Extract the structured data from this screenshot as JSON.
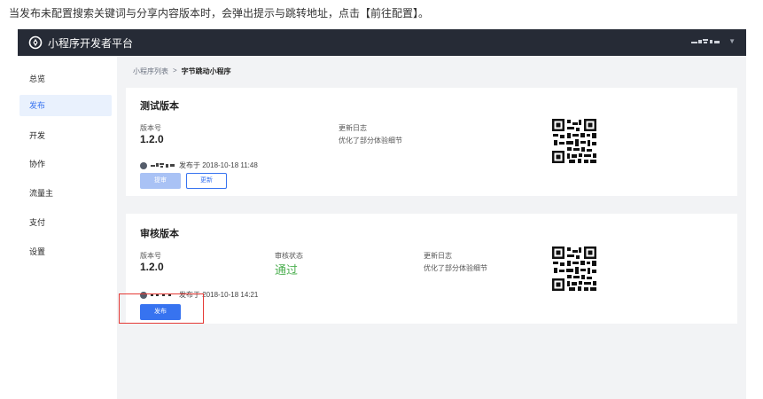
{
  "caption": "当发布未配置搜索关键词与分享内容版本时，会弹出提示与跳转地址，点击【前往配置】。",
  "header": {
    "app_title": "小程序开发者平台",
    "logo_icon": "compass-logo-icon",
    "user_menu_icon": "chevron-down-icon"
  },
  "sidebar": {
    "items": [
      {
        "label": "总览"
      },
      {
        "label": "发布",
        "active": true
      },
      {
        "label": "开发"
      },
      {
        "label": "协作"
      },
      {
        "label": "流量主"
      },
      {
        "label": "支付"
      },
      {
        "label": "设置"
      }
    ]
  },
  "breadcrumb": {
    "parent": "小程序列表",
    "separator": ">",
    "current": "字节跳动小程序"
  },
  "test_version": {
    "title": "测试版本",
    "version_label": "版本号",
    "version_value": "1.2.0",
    "changelog_label": "更新日志",
    "changelog_value": "优化了部分体验细节",
    "published_text": "发布于 2018-10-18 11:48",
    "btn_submit": "提审",
    "btn_update": "更新"
  },
  "review_version": {
    "title": "审核版本",
    "version_label": "版本号",
    "version_value": "1.2.0",
    "status_label": "审核状态",
    "status_value": "通过",
    "changelog_label": "更新日志",
    "changelog_value": "优化了部分体验细节",
    "published_text": "发布于 2018-10-18 14:21",
    "btn_publish": "发布"
  },
  "colors": {
    "topbar": "#262b36",
    "accent": "#3773f0",
    "success": "#4caf50",
    "highlight": "#e53935"
  }
}
